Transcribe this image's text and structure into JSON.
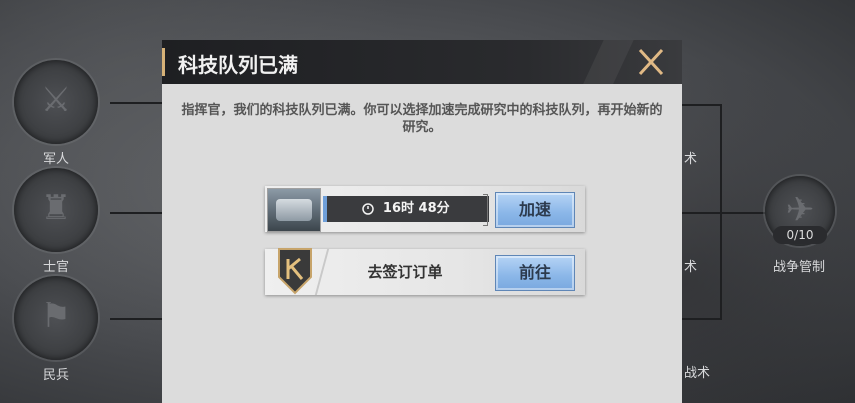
{
  "background_nodes": [
    {
      "label": "军人",
      "icon": "soldier-emblem-icon"
    },
    {
      "label": "士官",
      "icon": "officer-emblem-icon"
    },
    {
      "label": "民兵",
      "icon": "militia-emblem-icon"
    }
  ],
  "right_nodes": {
    "partial_labels": [
      "术",
      "术",
      "战术"
    ],
    "war_control": {
      "label": "战争管制",
      "counter": "0/10",
      "icon": "war-control-icon"
    }
  },
  "dialog": {
    "title": "科技队列已满",
    "close_icon": "close-icon",
    "message": "指挥官，我们的科技队列已满。你可以选择加速完成研究中的科技队列，再开始新的研究。",
    "research_row": {
      "timer_text": "16时 48分",
      "progress": 0.02,
      "button_label": "加速"
    },
    "contract_row": {
      "badge_icon": "k-badge-icon",
      "label": "去签订订单",
      "button_label": "前往"
    }
  },
  "colors": {
    "accent_gold": "#d7b278",
    "button_blue": "#8ab6e8",
    "header_dark": "#1e1f22",
    "panel_gray": "#dcdcdc"
  }
}
